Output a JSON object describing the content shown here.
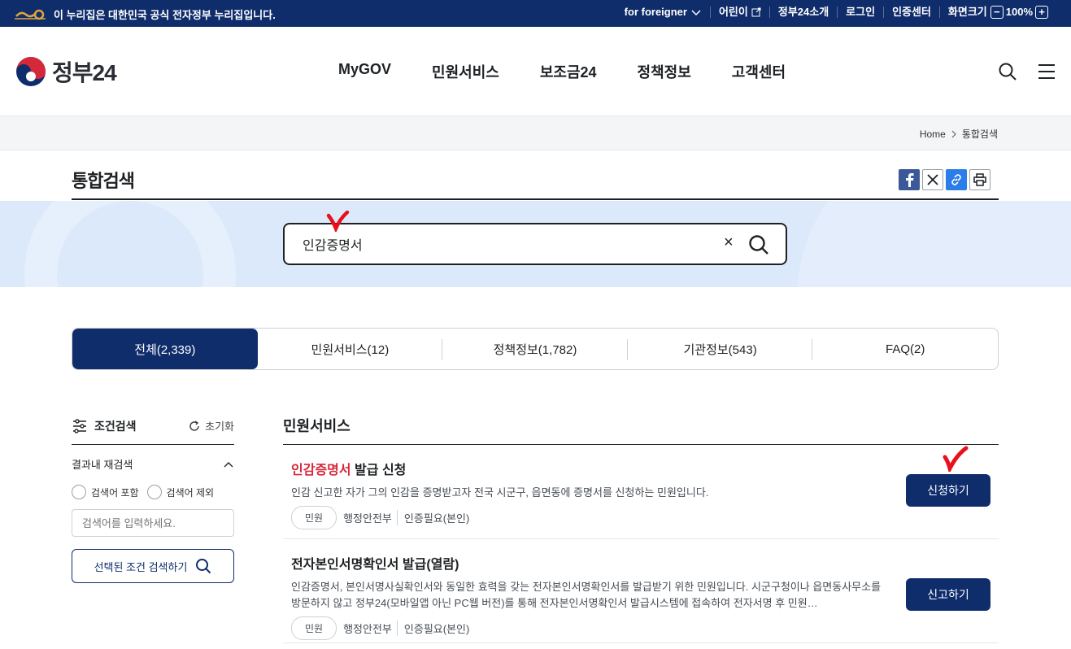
{
  "topbar": {
    "notice": "이 누리집은 대한민국 공식 전자정부 누리집입니다.",
    "foreigner": "for foreigner",
    "kids": "어린이",
    "about": "정부24소개",
    "login": "로그인",
    "cert": "인증센터",
    "screen": "화면크기",
    "zoom": "100%"
  },
  "header": {
    "logo_text": "정부24",
    "menus": [
      "MyGOV",
      "민원서비스",
      "보조금24",
      "정책정보",
      "고객센터"
    ]
  },
  "breadcrumb": {
    "home": "Home",
    "current": "통합검색"
  },
  "page": {
    "title": "통합검색"
  },
  "search": {
    "value": "인감증명서"
  },
  "tabs": [
    "전체(2,339)",
    "민원서비스(12)",
    "정책정보(1,782)",
    "기관정보(543)",
    "FAQ(2)"
  ],
  "sidebar": {
    "title": "조건검색",
    "reset": "초기화",
    "refine_label": "결과내 재검색",
    "include": "검색어 포함",
    "exclude": "검색어 제외",
    "input_placeholder": "검색어를 입력하세요.",
    "search_button": "선택된 조건 검색하기"
  },
  "main": {
    "section_title": "민원서비스",
    "results": [
      {
        "title_highlight": "인감증명서",
        "title_rest": " 발급 신청",
        "desc": "인감 신고한 자가 그의 인감을 증명받고자 전국 시군구, 읍면동에 증명서를 신청하는 민원입니다.",
        "badge": "민원",
        "org": "행정안전부",
        "auth": "인증필요(본인)",
        "button": "신청하기"
      },
      {
        "title": "전자본인서명확인서 발급(열람)",
        "desc": "인감증명서, 본인서명사실확인서와 동일한 효력을 갖는 전자본인서명확인서를 발급받기 위한 민원입니다. 시군구청이나 읍면동사무소를 방문하지 않고 정부24(모바일앱 아닌 PC웹 버전)를 통해 전자본인서명확인서 발급시스템에 접속하여 전자서명 후 민원…",
        "badge": "민원",
        "org": "행정안전부",
        "auth": "인증필요(본인)",
        "button": "신고하기"
      }
    ]
  },
  "colors": {
    "navy": "#0f2c6b",
    "highlight": "#d6283b",
    "annotation": "#e8101a"
  }
}
